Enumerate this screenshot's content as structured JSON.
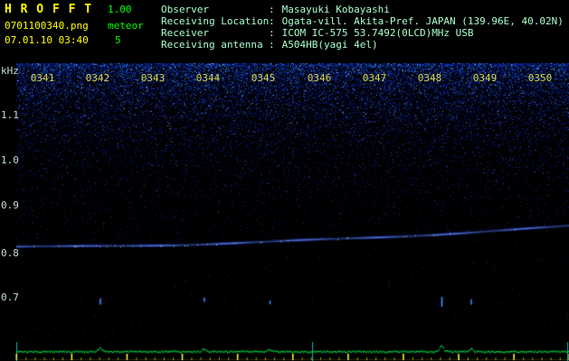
{
  "app": {
    "title": "H R O F F T",
    "version": "1.00",
    "filename": "0701100340.png",
    "mode": "meteor",
    "datetime": "07.01.10 03:40",
    "count": "5"
  },
  "info": {
    "separator": ":",
    "rows": [
      {
        "label": "Observer",
        "value": "Masayuki Kobayashi"
      },
      {
        "label": "Receiving Location",
        "value": "Ogata-vill. Akita-Pref. JAPAN (139.96E, 40.02N)"
      },
      {
        "label": "Receiver",
        "value": "ICOM IC-575 53.7492(0LCD)MHz USB"
      },
      {
        "label": "Receiving antenna",
        "value": "A504HB(yagi 4el)"
      }
    ]
  },
  "spectrogram": {
    "freq_unit": "kHz",
    "freq_labels": [
      "1.1",
      "1.0",
      "0.9",
      "0.8",
      "0.7"
    ],
    "freq_top_khz": 1.215,
    "freq_bottom_khz": 0.611,
    "time_labels": [
      "0341",
      "0342",
      "0343",
      "0344",
      "0345",
      "0346",
      "0347",
      "0348",
      "0349",
      "0350"
    ],
    "carrier": {
      "start_khz": 0.8125,
      "end_khz": 0.858
    },
    "echoes": [
      {
        "pos": 0.151,
        "freq_khz": 0.695,
        "len": 7
      },
      {
        "pos": 0.339,
        "freq_khz": 0.697,
        "len": 5
      },
      {
        "pos": 0.458,
        "freq_khz": 0.69,
        "len": 4
      },
      {
        "pos": 0.769,
        "freq_khz": 0.698,
        "len": 11
      },
      {
        "pos": 0.822,
        "freq_khz": 0.693,
        "len": 6
      }
    ]
  },
  "colors": {
    "accent_yellow": "#ffff00",
    "accent_green": "#00ff00",
    "info_text": "#aaffcc",
    "freq_axis_text": "#c4dede",
    "time_axis_text": "#d6d650",
    "noise_blue": "#2040ff",
    "carrier_blue": "#5a82ff",
    "meter_green": "#00dd44",
    "tick_yellow": "#cccc00",
    "marker_teal": "#00bbaa"
  }
}
